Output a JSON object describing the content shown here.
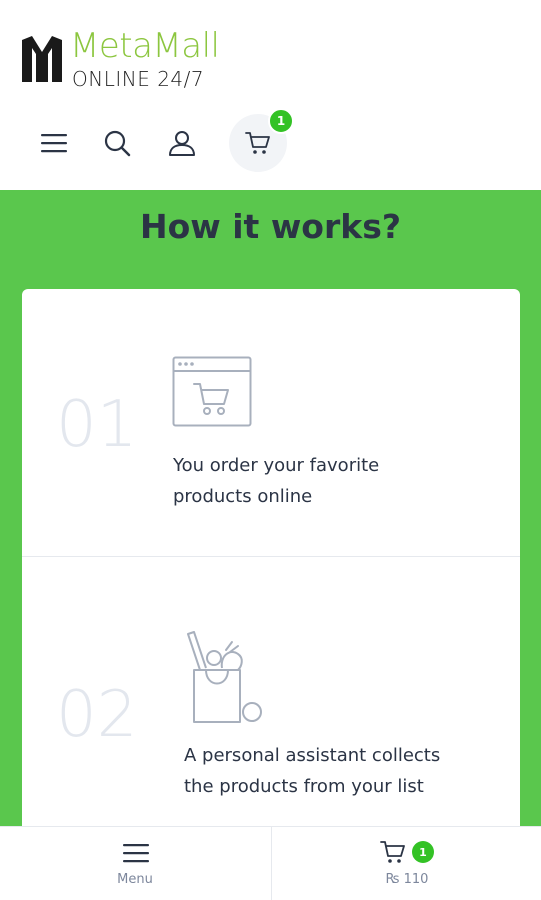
{
  "brand": {
    "name": "MetaMall",
    "tagline": "ONLINE 24/7",
    "colors": {
      "green": "#5ac74d",
      "logo_green": "#8cc63f",
      "badge_green": "#33c225",
      "dark_text": "#2b3445"
    }
  },
  "nav": {
    "icons": [
      "menu-icon",
      "search-icon",
      "user-icon",
      "cart-icon"
    ],
    "cart_count": "1"
  },
  "section": {
    "title": "How it works?",
    "steps": [
      {
        "number": "01",
        "icon": "browser-cart-icon",
        "text_line1": "You order your favorite",
        "text_line2": "products online"
      },
      {
        "number": "02",
        "icon": "grocery-bag-icon",
        "text_line1": "A personal assistant collects",
        "text_line2": "the products from your list"
      }
    ]
  },
  "bottom_bar": {
    "menu_label": "Menu",
    "cart_total": "₨ 110",
    "cart_count": "1"
  }
}
